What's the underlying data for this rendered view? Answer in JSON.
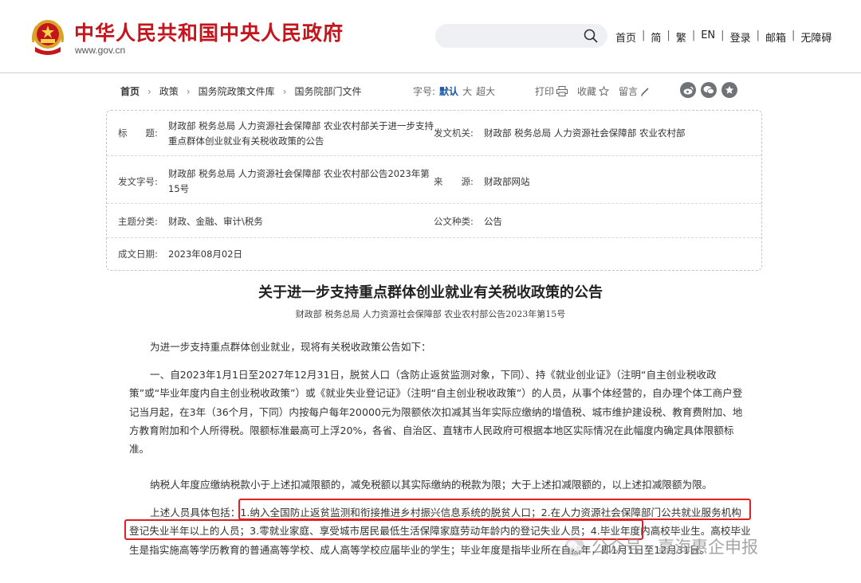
{
  "header": {
    "site_title": "中华人民共和国中央人民政府",
    "site_url": "www.gov.cn",
    "search_placeholder": "",
    "nav": [
      "首页",
      "简",
      "繁",
      "EN",
      "登录",
      "邮箱",
      "无障碍"
    ]
  },
  "breadcrumb": [
    "首页",
    "政策",
    "国务院政策文件库",
    "国务院部门文件"
  ],
  "font_size": {
    "label": "字号:",
    "options": [
      "默认",
      "大",
      "超大"
    ],
    "active": "默认"
  },
  "tools": {
    "print": "打印",
    "favorite": "收藏",
    "comment": "留言"
  },
  "share_icons": [
    "weibo-icon",
    "wechat-icon",
    "star-icon"
  ],
  "meta": {
    "title_label": "标　　题:",
    "title_value": "财政部 税务总局 人力资源社会保障部 农业农村部关于进一步支持重点群体创业就业有关税收政策的公告",
    "issuer_label": "发文机关:",
    "issuer_value": "财政部 税务总局 人力资源社会保障部 农业农村部",
    "docno_label": "发文字号:",
    "docno_value": "财政部 税务总局 人力资源社会保障部 农业农村部公告2023年第15号",
    "source_label": "来　　源:",
    "source_value": "财政部网站",
    "topic_label": "主题分类:",
    "topic_value": "财政、金融、审计\\税务",
    "type_label": "公文种类:",
    "type_value": "公告",
    "date_label": "成文日期:",
    "date_value": "2023年08月02日"
  },
  "article": {
    "title": "关于进一步支持重点群体创业就业有关税收政策的公告",
    "subtitle": "财政部 税务总局 人力资源社会保障部 农业农村部公告2023年第15号",
    "p1": "为进一步支持重点群体创业就业，现将有关税收政策公告如下：",
    "p2": "一、自2023年1月1日至2027年12月31日，脱贫人口（含防止返贫监测对象，下同）、持《就业创业证》（注明“自主创业税收政策”或“毕业年度内自主创业税收政策”）或《就业失业登记证》（注明“自主创业税收政策”）的人员，从事个体经营的，自办理个体工商户登记当月起，在3年（36个月，下同）内按每户每年20000元为限额依次扣减其当年实际应缴纳的增值税、城市维护建设税、教育费附加、地方教育附加和个人所得税。限额标准最高可上浮20%，各省、自治区、直辖市人民政府可根据本地区实际情况在此幅度内确定具体限额标准。",
    "p3": "纳税人年度应缴纳税款小于上述扣减限额的，减免税额以其实际缴纳的税款为限；大于上述扣减限额的，以上述扣减限额为限。",
    "p4": "上述人员具体包括：1.纳入全国防止返贫监测和衔接推进乡村振兴信息系统的脱贫人口；2.在人力资源社会保障部门公共就业服务机构登记失业半年以上的人员；3.零就业家庭、享受城市居民最低生活保障家庭劳动年龄内的登记失业人员；4.毕业年度内高校毕业生。高校毕业生是指实施高等学历教育的普通高等学校、成人高等学校应届毕业的学生；毕业年度是指毕业所在自然年，即1月1日至12月31日。"
  },
  "watermark": "公众号 · 嘉海惠企申报",
  "colors": {
    "brand_red": "#c4151c",
    "highlight": "#e02020",
    "link_blue": "#1a55a0"
  }
}
